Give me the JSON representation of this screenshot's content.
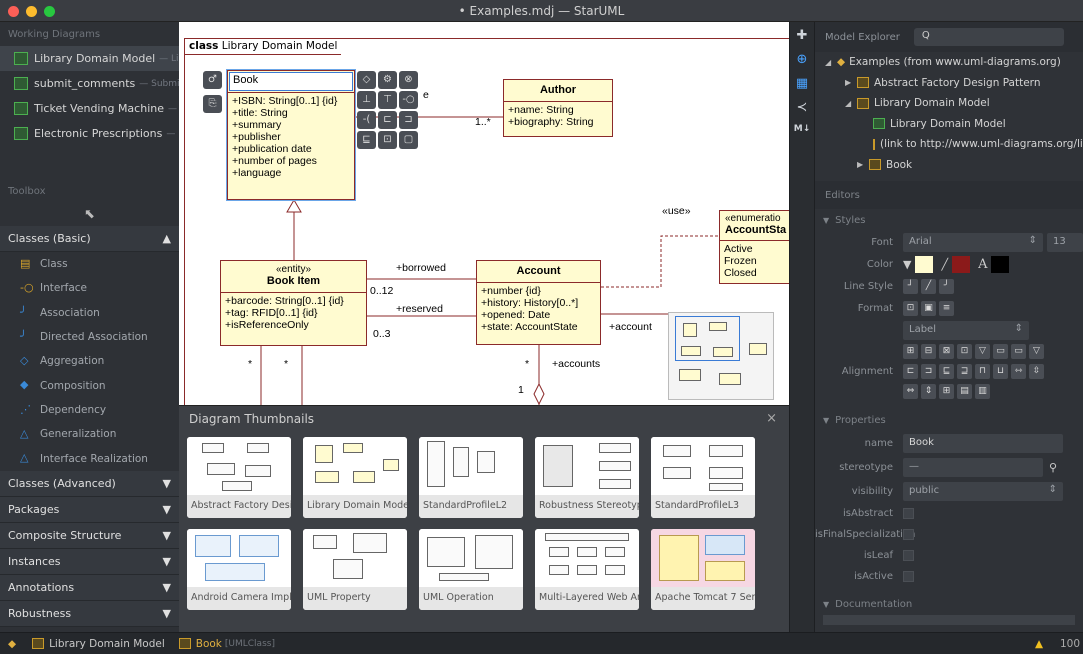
{
  "window": {
    "title": "• Examples.mdj — StarUML"
  },
  "working_diagrams": {
    "title": "Working Diagrams",
    "items": [
      {
        "label": "Library Domain Model",
        "sub": "— Lib"
      },
      {
        "label": "submit_comments",
        "sub": "— Submit"
      },
      {
        "label": "Ticket Vending Machine",
        "sub": "— T"
      },
      {
        "label": "Electronic Prescriptions",
        "sub": "— E"
      }
    ]
  },
  "toolbox": {
    "title": "Toolbox",
    "group_basic": "Classes (Basic)",
    "tools": [
      "Class",
      "Interface",
      "Association",
      "Directed Association",
      "Aggregation",
      "Composition",
      "Dependency",
      "Generalization",
      "Interface Realization"
    ],
    "groups": [
      "Classes (Advanced)",
      "Packages",
      "Composite Structure",
      "Instances",
      "Annotations",
      "Robustness"
    ]
  },
  "diagram": {
    "frame_kw": "class",
    "frame_name": "Library Domain Model",
    "book": {
      "name": "Book",
      "attrs": [
        "+ISBN: String[0..1] {id}",
        "+title: String",
        "+summary",
        "+publisher",
        "+publication date",
        "+number of pages",
        "+language"
      ]
    },
    "author": {
      "name": "Author",
      "attrs": [
        "+name: String",
        "+biography: String"
      ]
    },
    "bookitem": {
      "stereo": "«entity»",
      "name": "Book Item",
      "attrs": [
        "+barcode: String[0..1] {id}",
        "+tag: RFID[0..1] {id}",
        "+isReferenceOnly"
      ]
    },
    "account": {
      "name": "Account",
      "attrs": [
        "+number {id}",
        "+history: History[0..*]",
        "+opened: Date",
        "+state: AccountState"
      ]
    },
    "enum": {
      "stereo": "«enumeratio",
      "name": "AccountSta",
      "literals": [
        "Active",
        "Frozen",
        "Closed"
      ]
    },
    "labels": {
      "mult_author": "1..*",
      "e_label": "e",
      "borrowed": "+borrowed",
      "reserved": "+reserved",
      "m012": "0..12",
      "m03": "0..3",
      "use": "«use»",
      "account_role": "+account",
      "accounts_role": "+accounts",
      "star1": "*",
      "star2": "*",
      "star3": "*",
      "one": "1"
    }
  },
  "thumbnails": {
    "title": "Diagram Thumbnails",
    "close": "×",
    "items": [
      "Abstract Factory Design",
      "Library Domain Model",
      "StandardProfileL2",
      "Robustness Stereotype",
      "StandardProfileL3",
      "Android Camera Imple",
      "UML Property",
      "UML Operation",
      "Multi-Layered Web Arc",
      "Apache Tomcat 7 Serve"
    ]
  },
  "model_explorer": {
    "title": "Model Explorer",
    "search_placeholder": "Q",
    "tree": [
      {
        "label": "Examples (from www.uml-diagrams.org)",
        "level": 0
      },
      {
        "label": "Abstract Factory Design Pattern",
        "level": 1
      },
      {
        "label": "Library Domain Model",
        "level": 1
      },
      {
        "label": "Library Domain Model",
        "level": 2
      },
      {
        "label": "(link to http://www.uml-diagrams.org/library",
        "level": 2
      },
      {
        "label": "Book",
        "level": 1
      }
    ]
  },
  "editors": {
    "title": "Editors",
    "styles_title": "Styles",
    "font_label": "Font",
    "font_value": "Arial",
    "font_size": "13",
    "color_label": "Color",
    "line_style_label": "Line Style",
    "format_label": "Format",
    "format_value": "Label",
    "alignment_label": "Alignment",
    "colors": {
      "fill": "#fffbd0",
      "line": "#8b1a1a",
      "text": "#000000"
    }
  },
  "properties": {
    "title": "Properties",
    "name_label": "name",
    "name_value": "Book",
    "stereotype_label": "stereotype",
    "stereotype_value": "—",
    "visibility_label": "visibility",
    "visibility_value": "public",
    "checks": [
      "isAbstract",
      "isFinalSpecialization",
      "isLeaf",
      "isActive"
    ]
  },
  "documentation": {
    "title": "Documentation"
  },
  "status": {
    "diagram": "Library Domain Model",
    "element": "Book",
    "element_type": "[UMLClass]",
    "zoom": "100"
  }
}
